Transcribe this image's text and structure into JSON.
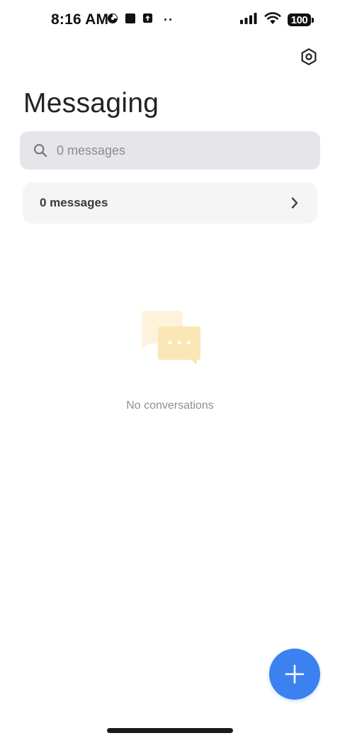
{
  "status_bar": {
    "time": "8:16 AM",
    "dots": "··",
    "battery_level": "100",
    "icons": [
      "media-player-icon",
      "stop-square-icon",
      "upload-box-icon",
      "signal-bars-icon",
      "wifi-icon",
      "battery-icon"
    ]
  },
  "header": {
    "title": "Messaging",
    "settings_icon": "gear-icon"
  },
  "search": {
    "placeholder": "0 messages",
    "value": "",
    "icon": "search-icon"
  },
  "messages_row": {
    "label": "0 messages",
    "icon": "chevron-right-icon"
  },
  "empty_state": {
    "text": "No conversations",
    "illustration": "chat-bubbles-icon"
  },
  "fab": {
    "icon": "plus-icon"
  },
  "colors": {
    "accent": "#3b82f0",
    "search_bg": "#e6e6ea",
    "row_bg": "#f5f5f5",
    "empty_text": "#8f8f8f",
    "bubble_light": "#fdf1d6",
    "bubble_mid": "#fbe3a8"
  }
}
